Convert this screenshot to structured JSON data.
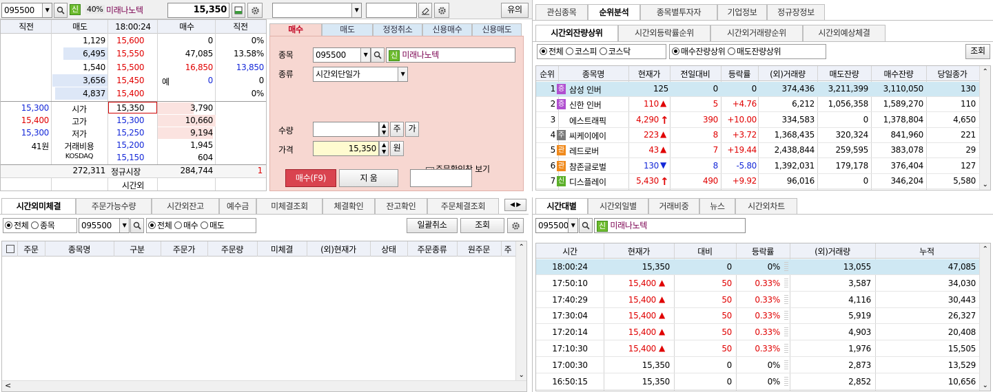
{
  "top_left": {
    "code": "095500",
    "credit": "신",
    "margin": "40%",
    "name": "미래나노텍",
    "price": "15,350"
  },
  "top_mid": {
    "warn_btn": "유의"
  },
  "orderbook": {
    "headers": [
      "직전",
      "매도",
      "18:00:24",
      "매수",
      "직전"
    ],
    "asks": [
      {
        "qty": "1,129",
        "price": "15,600",
        "bid": "0",
        "prev": "0%"
      },
      {
        "qty": "6,495",
        "price": "15,550",
        "bid": "47,085",
        "prev": "13.58%"
      },
      {
        "qty": "1,540",
        "price": "15,500",
        "bid": "16,850",
        "prev": "13,850"
      },
      {
        "qty": "3,656",
        "price": "15,450",
        "bid": "0",
        "prev": "0",
        "mark": "예"
      },
      {
        "qty": "4,837",
        "price": "15,400",
        "bid": "",
        "prev": "0%"
      }
    ],
    "bids": [
      {
        "lval": "15,300",
        "label": "시가",
        "price": "15,350",
        "qty": "3,790"
      },
      {
        "lval": "15,400",
        "label": "고가",
        "price": "15,300",
        "qty": "10,660"
      },
      {
        "lval": "15,300",
        "label": "저가",
        "price": "15,250",
        "qty": "9,194"
      },
      {
        "lval": "41원",
        "label": "거래비용",
        "price": "15,200",
        "qty": "1,945"
      },
      {
        "lval": "",
        "label": "KOSDAQ",
        "price": "15,150",
        "qty": "604"
      }
    ],
    "total_ask": "272,311",
    "total_label": "정규시장",
    "total_bid": "284,744",
    "total_diff": "1",
    "after_label": "시간외"
  },
  "order": {
    "tabs": [
      "매수",
      "매도",
      "정정취소",
      "신용매수",
      "신용매도"
    ],
    "stock_label": "종목",
    "code": "095500",
    "credit": "신",
    "name": "미래나노텍",
    "type_label": "종류",
    "type_value": "시간외단일가",
    "qty_label": "수량",
    "qty_value": "",
    "unit_btn": "주",
    "ga_btn": "가",
    "price_label": "가격",
    "price_value": "15,350",
    "won_btn": "원",
    "confirm": "주문확인창 보기",
    "buy_btn": "매수(F9)",
    "clear_btn": "지  움"
  },
  "rank": {
    "top_tabs": [
      "관심종목",
      "순위분석",
      "종목별투자자",
      "기업정보",
      "정규장정보"
    ],
    "sub_tabs": [
      "시간외잔량상위",
      "시간외등락률순위",
      "시간외거래량순위",
      "시간외예상체결"
    ],
    "filters": [
      "전체",
      "코스피",
      "코스닥"
    ],
    "sort": [
      "매수잔량상위",
      "매도잔량상위"
    ],
    "query_btn": "조회",
    "headers": [
      "순위",
      "종목명",
      "현재가",
      "전일대비",
      "등락률",
      "(외)거래량",
      "매도잔량",
      "매수잔량",
      "당일종가"
    ],
    "rows": [
      {
        "rank": "1",
        "badge": "증",
        "name": "삼성 인버",
        "price": "125",
        "arrow": "",
        "diff": "0",
        "rate": "0",
        "vol": "374,436",
        "ask": "3,211,399",
        "bid": "3,110,050",
        "close": "130"
      },
      {
        "rank": "2",
        "badge": "증",
        "name": "신한 인버",
        "price": "110",
        "arrow": "▲",
        "diff": "5",
        "rate": "+4.76",
        "vol": "6,212",
        "ask": "1,056,358",
        "bid": "1,589,270",
        "close": "110"
      },
      {
        "rank": "3",
        "badge": "",
        "name": "에스트래픽",
        "price": "4,290",
        "arrow": "↑",
        "diff": "390",
        "rate": "+10.00",
        "vol": "334,583",
        "ask": "0",
        "bid": "1,378,804",
        "close": "4,650"
      },
      {
        "rank": "4",
        "badge": "주",
        "name": "씨케이에이",
        "price": "223",
        "arrow": "▲",
        "diff": "8",
        "rate": "+3.72",
        "vol": "1,368,435",
        "ask": "320,324",
        "bid": "841,960",
        "close": "221"
      },
      {
        "rank": "5",
        "badge": "관",
        "name": "레드로버",
        "price": "43",
        "arrow": "▲",
        "diff": "7",
        "rate": "+19.44",
        "vol": "2,438,844",
        "ask": "259,595",
        "bid": "383,078",
        "close": "29"
      },
      {
        "rank": "6",
        "badge": "관",
        "name": "참존글로벌",
        "price": "130",
        "arrow": "▼",
        "diff": "8",
        "rate": "-5.80",
        "vol": "1,392,031",
        "ask": "179,178",
        "bid": "376,404",
        "close": "127"
      },
      {
        "rank": "7",
        "badge": "신",
        "name": "디스플레이",
        "price": "5,430",
        "arrow": "↑",
        "diff": "490",
        "rate": "+9.92",
        "vol": "96,016",
        "ask": "0",
        "bid": "346,204",
        "close": "5,580"
      }
    ]
  },
  "unfilled": {
    "tabs": [
      "시간외미체결",
      "주문가능수량",
      "시간외잔고",
      "예수금",
      "미체결조회",
      "체결확인",
      "잔고확인",
      "주문체결조회"
    ],
    "filter_all": "전체",
    "filter_stock": "종목",
    "code": "095500",
    "side_all": "전체",
    "side_buy": "매수",
    "side_sell": "매도",
    "bulk_cancel": "일괄취소",
    "query_btn": "조회",
    "headers": [
      "주문",
      "종목명",
      "구분",
      "주문가",
      "주문량",
      "미체결",
      "(외)현재가",
      "상태",
      "주문종류",
      "원주문",
      "주"
    ]
  },
  "timeseries": {
    "tabs": [
      "시간대별",
      "시간외일별",
      "거래비중",
      "뉴스",
      "시간외차트"
    ],
    "code": "095500",
    "credit": "신",
    "name": "미래나노텍",
    "headers": [
      "시간",
      "현재가",
      "대비",
      "등락률",
      "(외)거래량",
      "누적"
    ],
    "rows": [
      {
        "time": "18:00:24",
        "price": "15,350",
        "arrow": "",
        "diff": "0",
        "rate": "0%",
        "vol": "13,055",
        "cum": "47,085"
      },
      {
        "time": "17:50:10",
        "price": "15,400",
        "arrow": "▲",
        "diff": "50",
        "rate": "0.33%",
        "vol": "3,587",
        "cum": "34,030"
      },
      {
        "time": "17:40:29",
        "price": "15,400",
        "arrow": "▲",
        "diff": "50",
        "rate": "0.33%",
        "vol": "4,116",
        "cum": "30,443"
      },
      {
        "time": "17:30:04",
        "price": "15,400",
        "arrow": "▲",
        "diff": "50",
        "rate": "0.33%",
        "vol": "5,919",
        "cum": "26,327"
      },
      {
        "time": "17:20:14",
        "price": "15,400",
        "arrow": "▲",
        "diff": "50",
        "rate": "0.33%",
        "vol": "4,903",
        "cum": "20,408"
      },
      {
        "time": "17:10:30",
        "price": "15,400",
        "arrow": "▲",
        "diff": "50",
        "rate": "0.33%",
        "vol": "1,976",
        "cum": "15,505"
      },
      {
        "time": "17:00:30",
        "price": "15,350",
        "arrow": "",
        "diff": "0",
        "rate": "0%",
        "vol": "2,873",
        "cum": "13,529"
      },
      {
        "time": "16:50:15",
        "price": "15,350",
        "arrow": "",
        "diff": "0",
        "rate": "0%",
        "vol": "2,852",
        "cum": "10,656"
      }
    ]
  }
}
